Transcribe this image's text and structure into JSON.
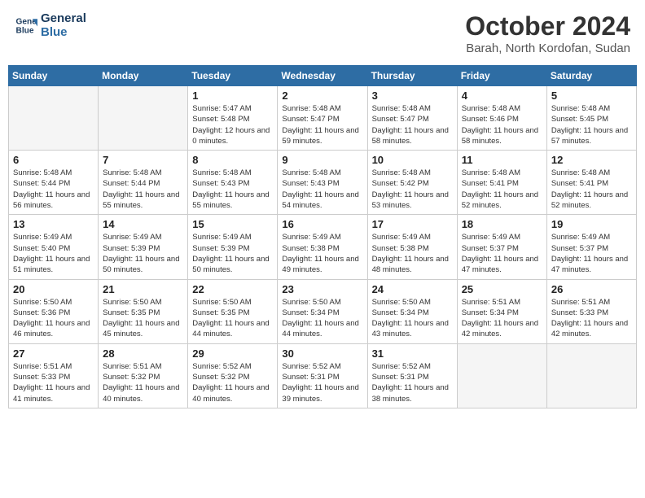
{
  "header": {
    "logo_line1": "General",
    "logo_line2": "Blue",
    "month": "October 2024",
    "location": "Barah, North Kordofan, Sudan"
  },
  "weekdays": [
    "Sunday",
    "Monday",
    "Tuesday",
    "Wednesday",
    "Thursday",
    "Friday",
    "Saturday"
  ],
  "weeks": [
    [
      {
        "day": "",
        "empty": true
      },
      {
        "day": "",
        "empty": true
      },
      {
        "day": "1",
        "sunrise": "5:47 AM",
        "sunset": "5:48 PM",
        "daylight": "12 hours and 0 minutes."
      },
      {
        "day": "2",
        "sunrise": "5:48 AM",
        "sunset": "5:47 PM",
        "daylight": "11 hours and 59 minutes."
      },
      {
        "day": "3",
        "sunrise": "5:48 AM",
        "sunset": "5:47 PM",
        "daylight": "11 hours and 58 minutes."
      },
      {
        "day": "4",
        "sunrise": "5:48 AM",
        "sunset": "5:46 PM",
        "daylight": "11 hours and 58 minutes."
      },
      {
        "day": "5",
        "sunrise": "5:48 AM",
        "sunset": "5:45 PM",
        "daylight": "11 hours and 57 minutes."
      }
    ],
    [
      {
        "day": "6",
        "sunrise": "5:48 AM",
        "sunset": "5:44 PM",
        "daylight": "11 hours and 56 minutes."
      },
      {
        "day": "7",
        "sunrise": "5:48 AM",
        "sunset": "5:44 PM",
        "daylight": "11 hours and 55 minutes."
      },
      {
        "day": "8",
        "sunrise": "5:48 AM",
        "sunset": "5:43 PM",
        "daylight": "11 hours and 55 minutes."
      },
      {
        "day": "9",
        "sunrise": "5:48 AM",
        "sunset": "5:43 PM",
        "daylight": "11 hours and 54 minutes."
      },
      {
        "day": "10",
        "sunrise": "5:48 AM",
        "sunset": "5:42 PM",
        "daylight": "11 hours and 53 minutes."
      },
      {
        "day": "11",
        "sunrise": "5:48 AM",
        "sunset": "5:41 PM",
        "daylight": "11 hours and 52 minutes."
      },
      {
        "day": "12",
        "sunrise": "5:48 AM",
        "sunset": "5:41 PM",
        "daylight": "11 hours and 52 minutes."
      }
    ],
    [
      {
        "day": "13",
        "sunrise": "5:49 AM",
        "sunset": "5:40 PM",
        "daylight": "11 hours and 51 minutes."
      },
      {
        "day": "14",
        "sunrise": "5:49 AM",
        "sunset": "5:39 PM",
        "daylight": "11 hours and 50 minutes."
      },
      {
        "day": "15",
        "sunrise": "5:49 AM",
        "sunset": "5:39 PM",
        "daylight": "11 hours and 50 minutes."
      },
      {
        "day": "16",
        "sunrise": "5:49 AM",
        "sunset": "5:38 PM",
        "daylight": "11 hours and 49 minutes."
      },
      {
        "day": "17",
        "sunrise": "5:49 AM",
        "sunset": "5:38 PM",
        "daylight": "11 hours and 48 minutes."
      },
      {
        "day": "18",
        "sunrise": "5:49 AM",
        "sunset": "5:37 PM",
        "daylight": "11 hours and 47 minutes."
      },
      {
        "day": "19",
        "sunrise": "5:49 AM",
        "sunset": "5:37 PM",
        "daylight": "11 hours and 47 minutes."
      }
    ],
    [
      {
        "day": "20",
        "sunrise": "5:50 AM",
        "sunset": "5:36 PM",
        "daylight": "11 hours and 46 minutes."
      },
      {
        "day": "21",
        "sunrise": "5:50 AM",
        "sunset": "5:35 PM",
        "daylight": "11 hours and 45 minutes."
      },
      {
        "day": "22",
        "sunrise": "5:50 AM",
        "sunset": "5:35 PM",
        "daylight": "11 hours and 44 minutes."
      },
      {
        "day": "23",
        "sunrise": "5:50 AM",
        "sunset": "5:34 PM",
        "daylight": "11 hours and 44 minutes."
      },
      {
        "day": "24",
        "sunrise": "5:50 AM",
        "sunset": "5:34 PM",
        "daylight": "11 hours and 43 minutes."
      },
      {
        "day": "25",
        "sunrise": "5:51 AM",
        "sunset": "5:34 PM",
        "daylight": "11 hours and 42 minutes."
      },
      {
        "day": "26",
        "sunrise": "5:51 AM",
        "sunset": "5:33 PM",
        "daylight": "11 hours and 42 minutes."
      }
    ],
    [
      {
        "day": "27",
        "sunrise": "5:51 AM",
        "sunset": "5:33 PM",
        "daylight": "11 hours and 41 minutes."
      },
      {
        "day": "28",
        "sunrise": "5:51 AM",
        "sunset": "5:32 PM",
        "daylight": "11 hours and 40 minutes."
      },
      {
        "day": "29",
        "sunrise": "5:52 AM",
        "sunset": "5:32 PM",
        "daylight": "11 hours and 40 minutes."
      },
      {
        "day": "30",
        "sunrise": "5:52 AM",
        "sunset": "5:31 PM",
        "daylight": "11 hours and 39 minutes."
      },
      {
        "day": "31",
        "sunrise": "5:52 AM",
        "sunset": "5:31 PM",
        "daylight": "11 hours and 38 minutes."
      },
      {
        "day": "",
        "empty": true
      },
      {
        "day": "",
        "empty": true
      }
    ]
  ]
}
